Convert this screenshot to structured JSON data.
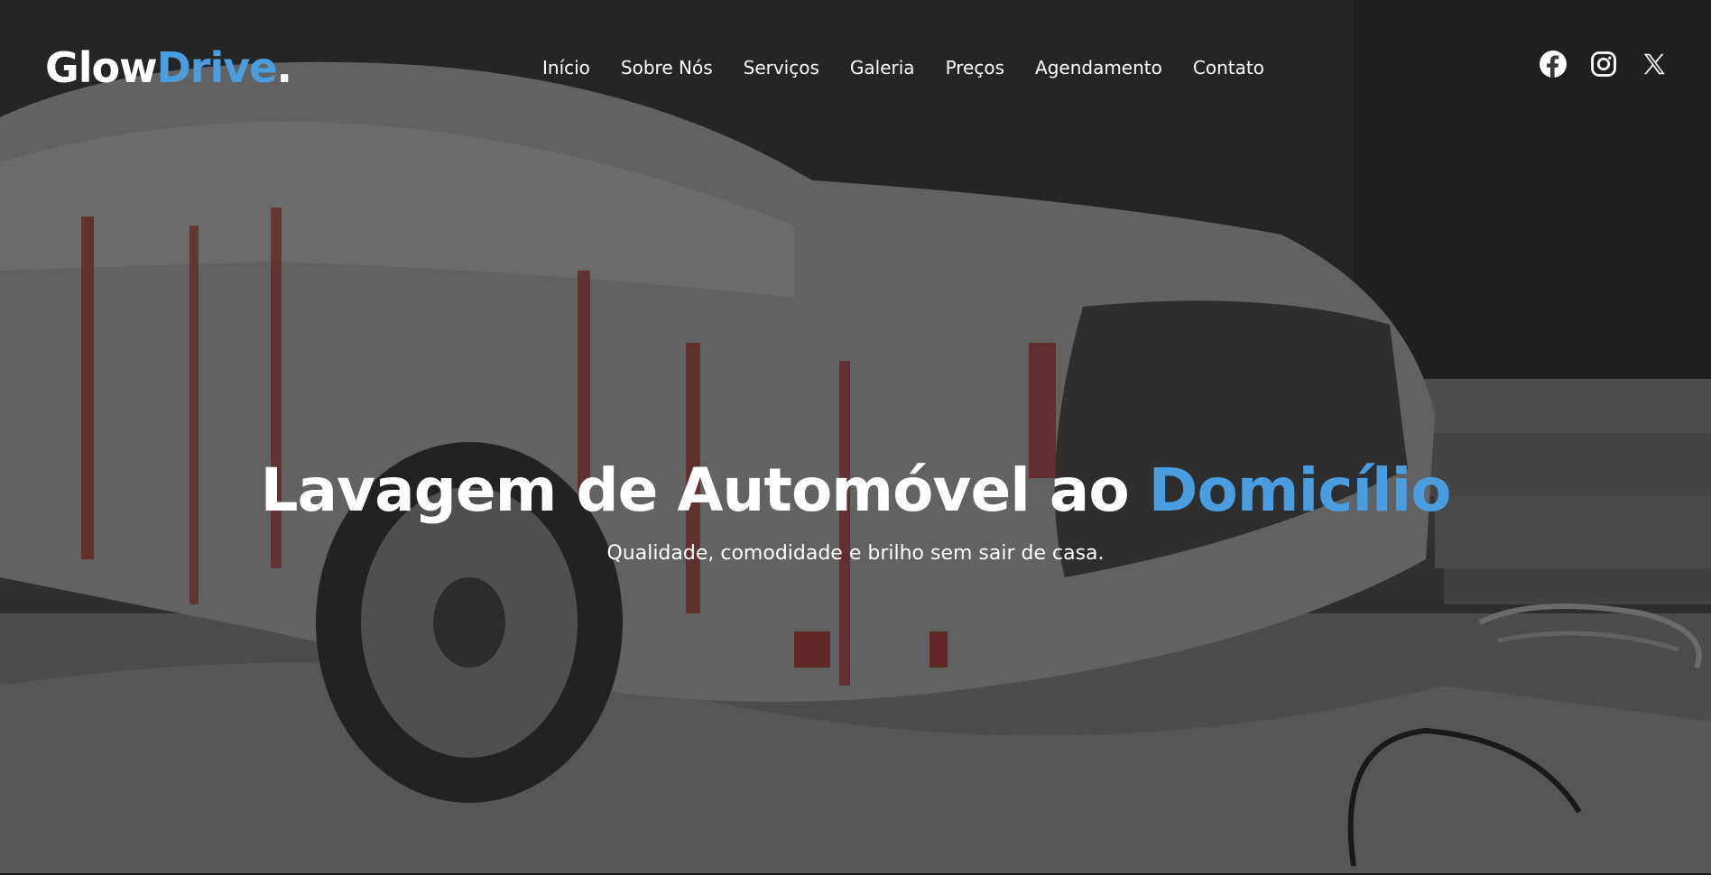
{
  "brand": {
    "name_part1": "Glow",
    "name_part2": "Drive",
    "name_dot": ".",
    "accent_color": "#4a9ee0"
  },
  "nav": {
    "items": [
      {
        "label": "Início"
      },
      {
        "label": "Sobre Nós"
      },
      {
        "label": "Serviços"
      },
      {
        "label": "Galeria"
      },
      {
        "label": "Preços"
      },
      {
        "label": "Agendamento"
      },
      {
        "label": "Contato"
      }
    ]
  },
  "social": {
    "icons": [
      "facebook-icon",
      "instagram-icon",
      "x-icon"
    ]
  },
  "hero": {
    "title_part1": "Lavagem de Automóvel ao ",
    "title_part2": "Domicílio",
    "subtitle": "Qualidade, comodidade e brilho sem sair de casa.",
    "background": "foam-covered-car-photo"
  }
}
